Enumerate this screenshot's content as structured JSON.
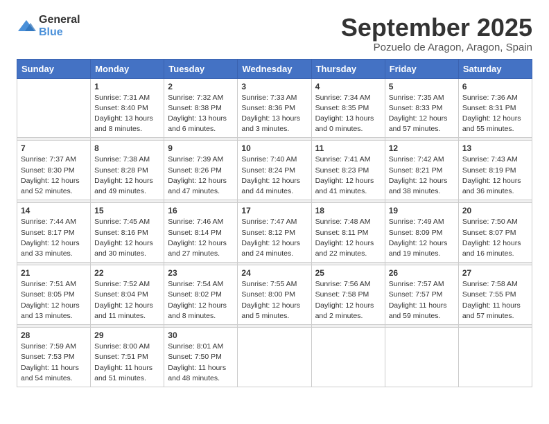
{
  "header": {
    "logo_general": "General",
    "logo_blue": "Blue",
    "month": "September 2025",
    "location": "Pozuelo de Aragon, Aragon, Spain"
  },
  "weekdays": [
    "Sunday",
    "Monday",
    "Tuesday",
    "Wednesday",
    "Thursday",
    "Friday",
    "Saturday"
  ],
  "weeks": [
    [
      {
        "day": "",
        "sunrise": "",
        "sunset": "",
        "daylight": ""
      },
      {
        "day": "1",
        "sunrise": "Sunrise: 7:31 AM",
        "sunset": "Sunset: 8:40 PM",
        "daylight": "Daylight: 13 hours and 8 minutes."
      },
      {
        "day": "2",
        "sunrise": "Sunrise: 7:32 AM",
        "sunset": "Sunset: 8:38 PM",
        "daylight": "Daylight: 13 hours and 6 minutes."
      },
      {
        "day": "3",
        "sunrise": "Sunrise: 7:33 AM",
        "sunset": "Sunset: 8:36 PM",
        "daylight": "Daylight: 13 hours and 3 minutes."
      },
      {
        "day": "4",
        "sunrise": "Sunrise: 7:34 AM",
        "sunset": "Sunset: 8:35 PM",
        "daylight": "Daylight: 13 hours and 0 minutes."
      },
      {
        "day": "5",
        "sunrise": "Sunrise: 7:35 AM",
        "sunset": "Sunset: 8:33 PM",
        "daylight": "Daylight: 12 hours and 57 minutes."
      },
      {
        "day": "6",
        "sunrise": "Sunrise: 7:36 AM",
        "sunset": "Sunset: 8:31 PM",
        "daylight": "Daylight: 12 hours and 55 minutes."
      }
    ],
    [
      {
        "day": "7",
        "sunrise": "Sunrise: 7:37 AM",
        "sunset": "Sunset: 8:30 PM",
        "daylight": "Daylight: 12 hours and 52 minutes."
      },
      {
        "day": "8",
        "sunrise": "Sunrise: 7:38 AM",
        "sunset": "Sunset: 8:28 PM",
        "daylight": "Daylight: 12 hours and 49 minutes."
      },
      {
        "day": "9",
        "sunrise": "Sunrise: 7:39 AM",
        "sunset": "Sunset: 8:26 PM",
        "daylight": "Daylight: 12 hours and 47 minutes."
      },
      {
        "day": "10",
        "sunrise": "Sunrise: 7:40 AM",
        "sunset": "Sunset: 8:24 PM",
        "daylight": "Daylight: 12 hours and 44 minutes."
      },
      {
        "day": "11",
        "sunrise": "Sunrise: 7:41 AM",
        "sunset": "Sunset: 8:23 PM",
        "daylight": "Daylight: 12 hours and 41 minutes."
      },
      {
        "day": "12",
        "sunrise": "Sunrise: 7:42 AM",
        "sunset": "Sunset: 8:21 PM",
        "daylight": "Daylight: 12 hours and 38 minutes."
      },
      {
        "day": "13",
        "sunrise": "Sunrise: 7:43 AM",
        "sunset": "Sunset: 8:19 PM",
        "daylight": "Daylight: 12 hours and 36 minutes."
      }
    ],
    [
      {
        "day": "14",
        "sunrise": "Sunrise: 7:44 AM",
        "sunset": "Sunset: 8:17 PM",
        "daylight": "Daylight: 12 hours and 33 minutes."
      },
      {
        "day": "15",
        "sunrise": "Sunrise: 7:45 AM",
        "sunset": "Sunset: 8:16 PM",
        "daylight": "Daylight: 12 hours and 30 minutes."
      },
      {
        "day": "16",
        "sunrise": "Sunrise: 7:46 AM",
        "sunset": "Sunset: 8:14 PM",
        "daylight": "Daylight: 12 hours and 27 minutes."
      },
      {
        "day": "17",
        "sunrise": "Sunrise: 7:47 AM",
        "sunset": "Sunset: 8:12 PM",
        "daylight": "Daylight: 12 hours and 24 minutes."
      },
      {
        "day": "18",
        "sunrise": "Sunrise: 7:48 AM",
        "sunset": "Sunset: 8:11 PM",
        "daylight": "Daylight: 12 hours and 22 minutes."
      },
      {
        "day": "19",
        "sunrise": "Sunrise: 7:49 AM",
        "sunset": "Sunset: 8:09 PM",
        "daylight": "Daylight: 12 hours and 19 minutes."
      },
      {
        "day": "20",
        "sunrise": "Sunrise: 7:50 AM",
        "sunset": "Sunset: 8:07 PM",
        "daylight": "Daylight: 12 hours and 16 minutes."
      }
    ],
    [
      {
        "day": "21",
        "sunrise": "Sunrise: 7:51 AM",
        "sunset": "Sunset: 8:05 PM",
        "daylight": "Daylight: 12 hours and 13 minutes."
      },
      {
        "day": "22",
        "sunrise": "Sunrise: 7:52 AM",
        "sunset": "Sunset: 8:04 PM",
        "daylight": "Daylight: 12 hours and 11 minutes."
      },
      {
        "day": "23",
        "sunrise": "Sunrise: 7:54 AM",
        "sunset": "Sunset: 8:02 PM",
        "daylight": "Daylight: 12 hours and 8 minutes."
      },
      {
        "day": "24",
        "sunrise": "Sunrise: 7:55 AM",
        "sunset": "Sunset: 8:00 PM",
        "daylight": "Daylight: 12 hours and 5 minutes."
      },
      {
        "day": "25",
        "sunrise": "Sunrise: 7:56 AM",
        "sunset": "Sunset: 7:58 PM",
        "daylight": "Daylight: 12 hours and 2 minutes."
      },
      {
        "day": "26",
        "sunrise": "Sunrise: 7:57 AM",
        "sunset": "Sunset: 7:57 PM",
        "daylight": "Daylight: 11 hours and 59 minutes."
      },
      {
        "day": "27",
        "sunrise": "Sunrise: 7:58 AM",
        "sunset": "Sunset: 7:55 PM",
        "daylight": "Daylight: 11 hours and 57 minutes."
      }
    ],
    [
      {
        "day": "28",
        "sunrise": "Sunrise: 7:59 AM",
        "sunset": "Sunset: 7:53 PM",
        "daylight": "Daylight: 11 hours and 54 minutes."
      },
      {
        "day": "29",
        "sunrise": "Sunrise: 8:00 AM",
        "sunset": "Sunset: 7:51 PM",
        "daylight": "Daylight: 11 hours and 51 minutes."
      },
      {
        "day": "30",
        "sunrise": "Sunrise: 8:01 AM",
        "sunset": "Sunset: 7:50 PM",
        "daylight": "Daylight: 11 hours and 48 minutes."
      },
      {
        "day": "",
        "sunrise": "",
        "sunset": "",
        "daylight": ""
      },
      {
        "day": "",
        "sunrise": "",
        "sunset": "",
        "daylight": ""
      },
      {
        "day": "",
        "sunrise": "",
        "sunset": "",
        "daylight": ""
      },
      {
        "day": "",
        "sunrise": "",
        "sunset": "",
        "daylight": ""
      }
    ]
  ]
}
